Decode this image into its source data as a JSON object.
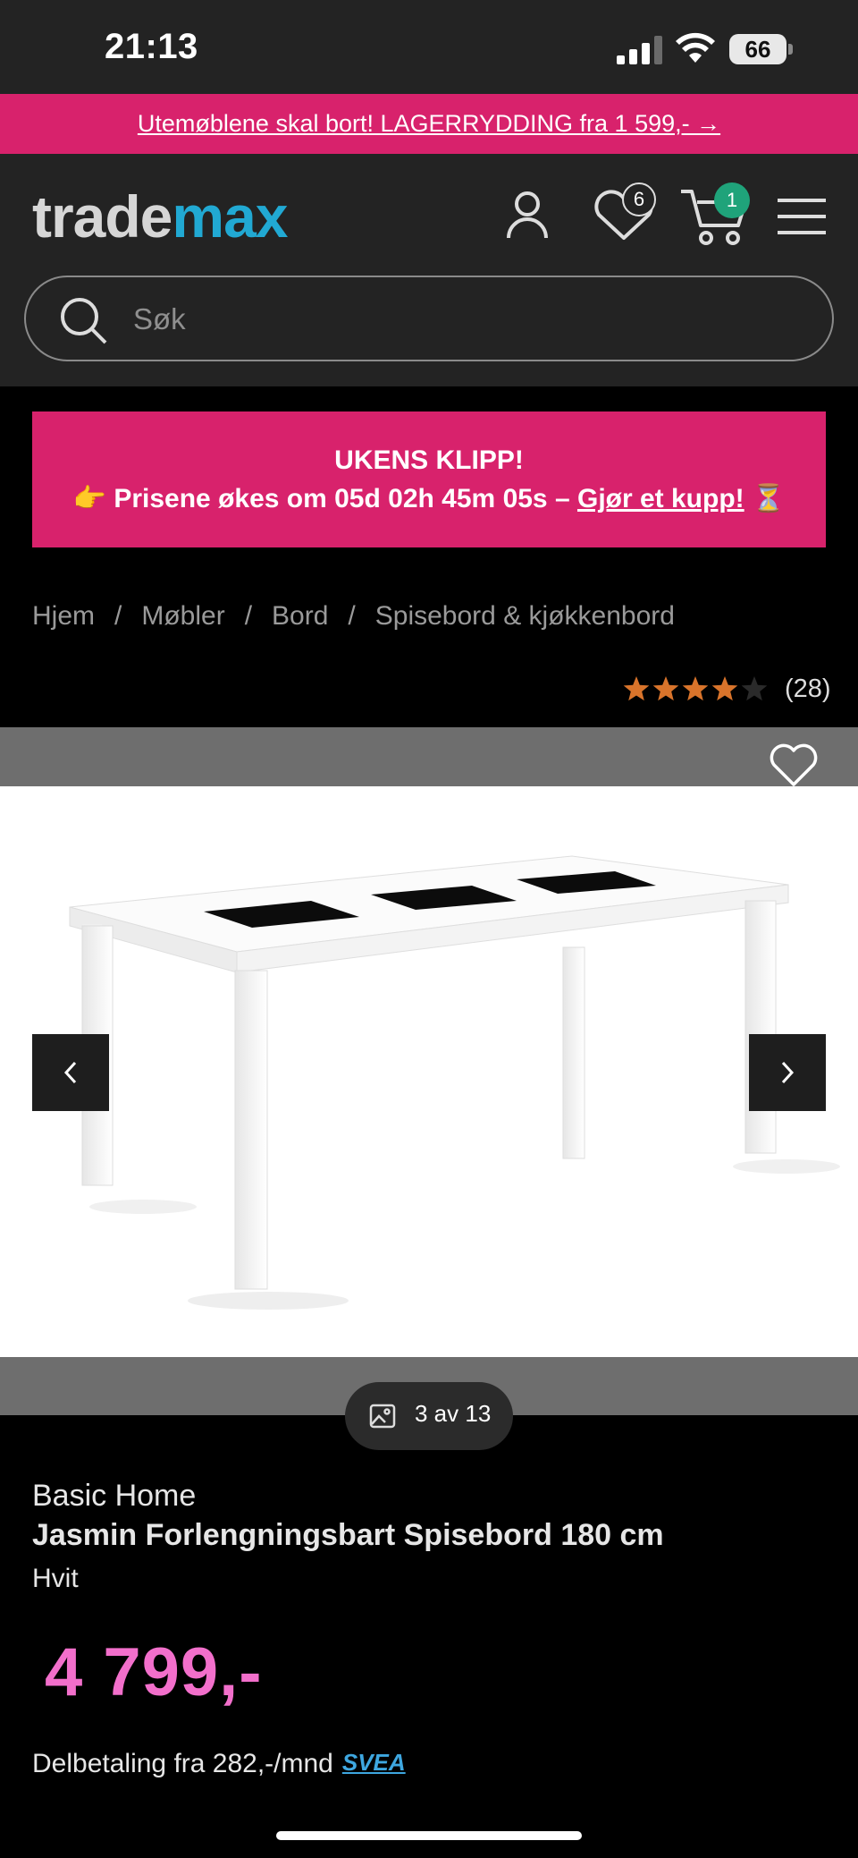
{
  "status_bar": {
    "time": "21:13",
    "battery": "66"
  },
  "promo": {
    "text": "Utemøblene skal bort! LAGERRYDDING fra 1 599,- →"
  },
  "header": {
    "logo_part1": "trade",
    "logo_part2": "max",
    "wishlist_count": "6",
    "cart_count": "1",
    "search_placeholder": "Søk"
  },
  "deal": {
    "title": "UKENS KLIPP!",
    "emoji_start": "👉",
    "text": "Prisene økes om 05d 02h 45m 05s –",
    "link": "Gjør et kupp!",
    "emoji_end": "⏳"
  },
  "breadcrumb": {
    "items": [
      "Hjem",
      "Møbler",
      "Bord",
      "Spisebord & kjøkkenbord"
    ],
    "separator": "/"
  },
  "rating": {
    "stars": 4,
    "max_stars": 5,
    "count": "(28)"
  },
  "gallery": {
    "counter": "3 av 13"
  },
  "product": {
    "brand": "Basic Home",
    "name": "Jasmin Forlengningsbart Spisebord 180 cm",
    "variant": "Hvit",
    "price": "4 799,-",
    "installment": "Delbetaling fra 282,-/mnd",
    "installment_provider": "SVEA"
  },
  "colors": {
    "accent": "#d8226c",
    "price": "#f26fcb",
    "logo_blue": "#21a9d3",
    "badge_green": "#1fa37a",
    "star": "#d9742b"
  }
}
